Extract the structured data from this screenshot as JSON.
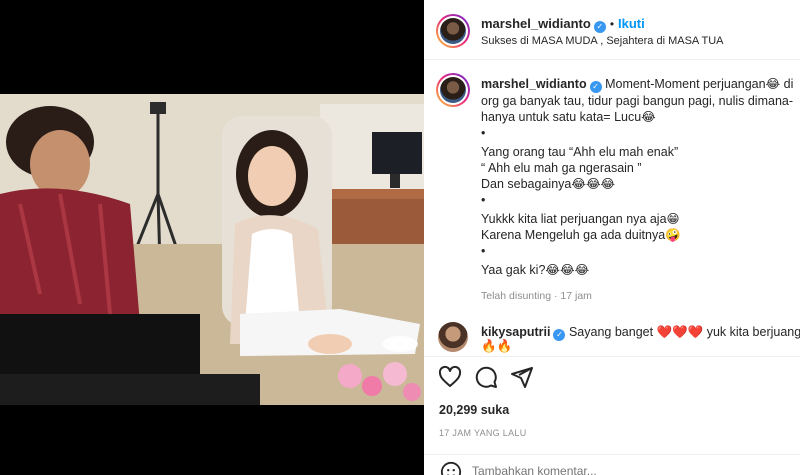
{
  "post": {
    "username": "marshel_widianto",
    "verified_icon": "verified-badge-icon",
    "separator": "•",
    "follow_label": "Ikuti",
    "subtitle": "Sukses di MASA MUDA , Sejahtera di MASA TUA"
  },
  "caption": {
    "username": "marshel_widianto",
    "lines": [
      "Moment-Moment perjuangan😂 di",
      "org ga banyak tau, tidur pagi bangun pagi, nulis dimana-",
      "hanya untuk satu kata= Lucu😂",
      "•",
      "Yang orang tau “Ahh elu mah enak”",
      "“ Ahh elu mah ga ngerasain ”",
      "Dan sebagainya😂😂😂",
      "•",
      "Yukkk kita liat perjuangan nya aja😁",
      "Karena Mengeluh ga ada duitnya🤪",
      "•",
      "Yaa gak ki?😂😂😂"
    ],
    "edited": "Telah disunting",
    "edited_sep": "·",
    "edited_time": "17 jam"
  },
  "comment": {
    "username": "kikysaputrii",
    "text": "Sayang banget ❤️❤️❤️ yuk kita berjuang",
    "extra": "🔥🔥"
  },
  "actions": {
    "likes": "20,299 suka",
    "timestamp": "17 JAM YANG LALU",
    "comment_placeholder": "Tambahkan komentar..."
  },
  "colors": {
    "accent": "#0095f6",
    "verified": "#3897f0",
    "heart": "#ed4956"
  }
}
